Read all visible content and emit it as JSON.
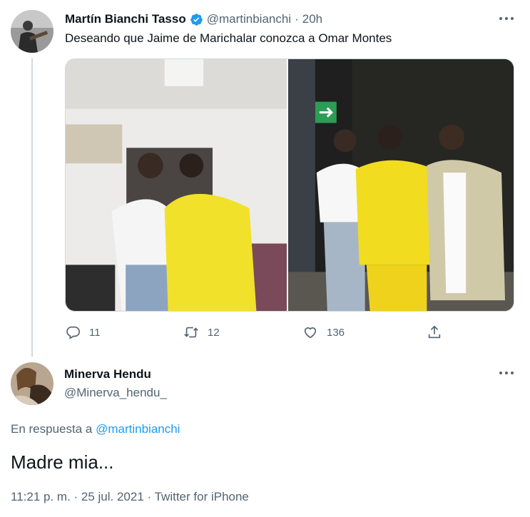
{
  "tweet": {
    "author_name": "Martín Bianchi Tasso",
    "author_handle": "@martinbianchi",
    "separator": "·",
    "time": "20h",
    "text": "Deseando que Jaime de Marichalar conozca a Omar Montes",
    "actions": {
      "replies": "11",
      "retweets": "12",
      "likes": "136"
    }
  },
  "reply": {
    "author_name": "Minerva Hendu",
    "author_handle": "@Minerva_hendu_",
    "in_reply_prefix": "En respuesta a",
    "in_reply_handle": "@martinbianchi",
    "text": "Madre mia...",
    "meta": "11:21 p. m. · 25 jul. 2021 · Twitter for iPhone"
  },
  "colors": {
    "link": "#1d9bf0",
    "verified": "#1d9bf0",
    "muted": "#536471"
  }
}
